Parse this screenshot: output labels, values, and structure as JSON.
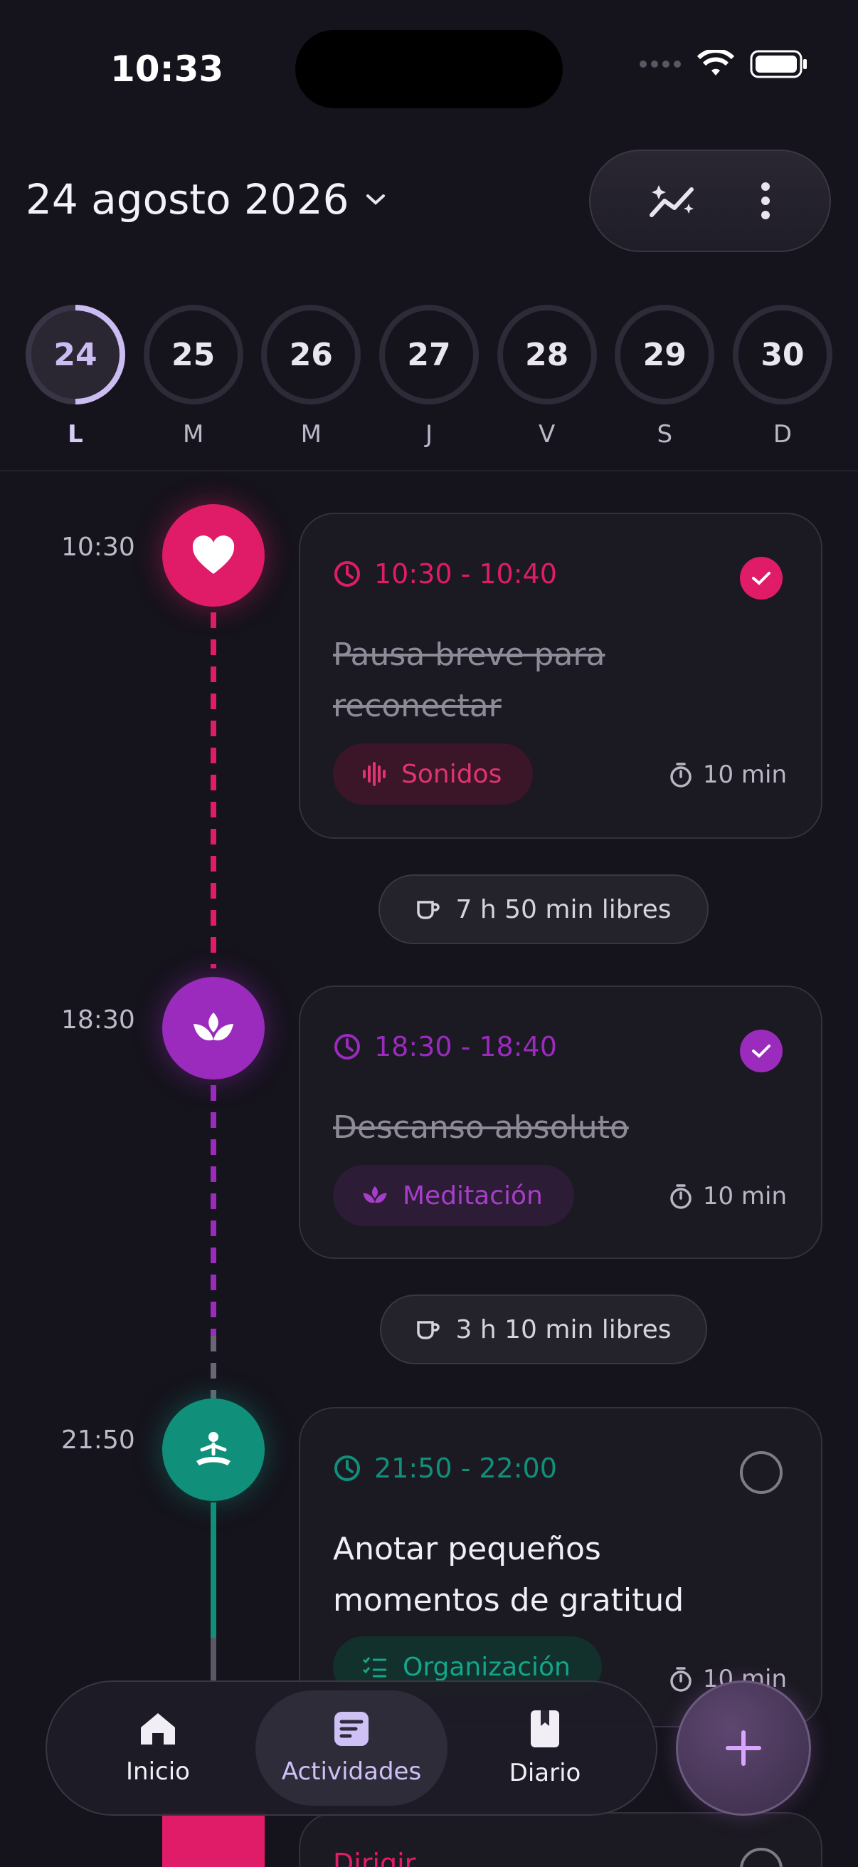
{
  "status_bar": {
    "time": "10:33"
  },
  "header": {
    "date_title": "24 agosto 2026"
  },
  "week": [
    {
      "num": "24",
      "letter": "L",
      "active": true
    },
    {
      "num": "25",
      "letter": "M"
    },
    {
      "num": "26",
      "letter": "M"
    },
    {
      "num": "27",
      "letter": "J"
    },
    {
      "num": "28",
      "letter": "V"
    },
    {
      "num": "29",
      "letter": "S"
    },
    {
      "num": "30",
      "letter": "D"
    }
  ],
  "activities": [
    {
      "time_label": "10:30",
      "range": "10:30 - 10:40",
      "title": "Pausa breve para reconectar",
      "category": "Sonidos",
      "duration": "10 min",
      "done": true,
      "color": "#e01c68",
      "icon": "heart-icon"
    },
    {
      "time_label": "18:30",
      "range": "18:30 - 18:40",
      "title": "Descanso absoluto",
      "category": "Meditación",
      "duration": "10 min",
      "done": true,
      "color": "#9a2bbd",
      "icon": "lotus-icon"
    },
    {
      "time_label": "21:50",
      "range": "21:50 - 22:00",
      "title": "Anotar pequeños momentos de gratitud",
      "category": "Organización",
      "duration": "10 min",
      "done": false,
      "color": "#10907a",
      "icon": "meditation-icon"
    }
  ],
  "free_slots": [
    "7 h 50 min libres",
    "3 h 10 min libres"
  ],
  "bottom_nav": {
    "home": "Inicio",
    "activities": "Actividades",
    "journal": "Diario"
  },
  "next_card_partial": "Dirigir..."
}
